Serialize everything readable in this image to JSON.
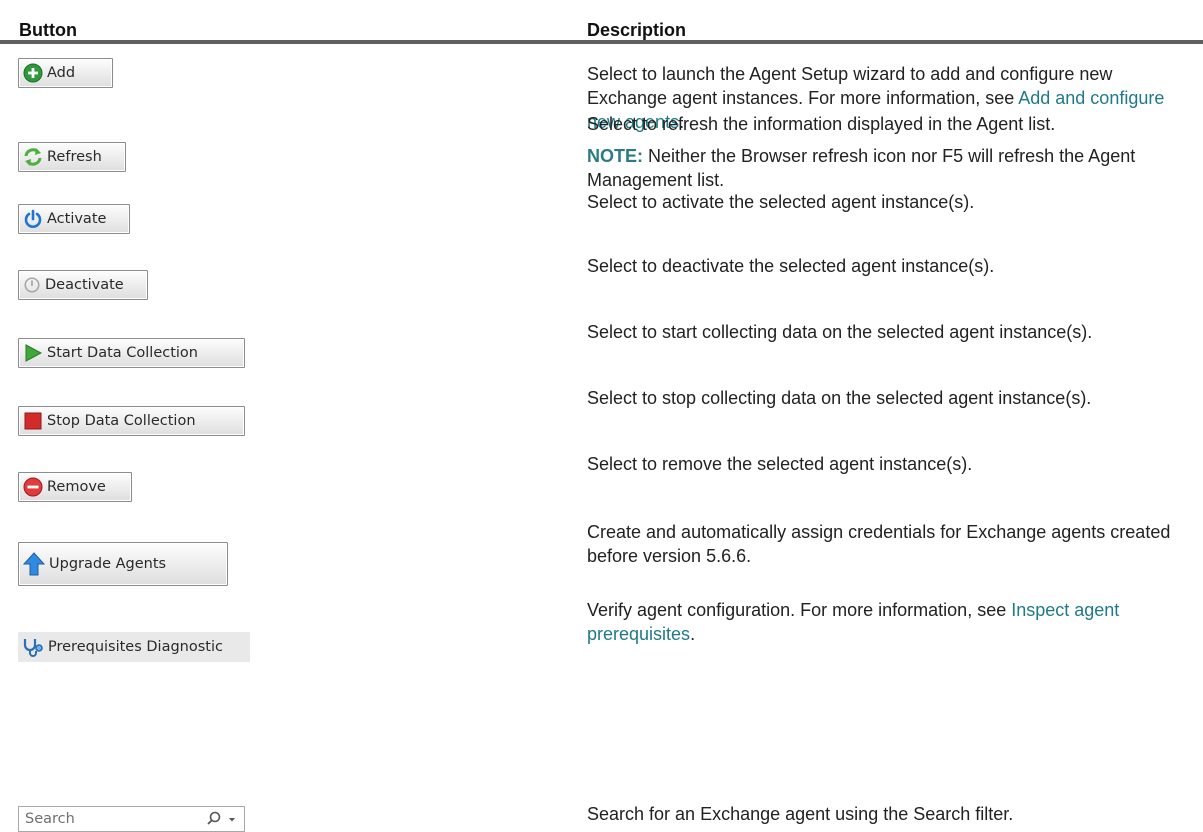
{
  "table": {
    "header": {
      "button": "Button",
      "description": "Description"
    },
    "rows": [
      {
        "button_label": "Add",
        "description": "Select to launch the Agent Setup wizard to add and configure new Exchange agent instances. For more information, see ",
        "link": "Add and configure new agents",
        "after_link": "."
      },
      {
        "button_label": "Refresh",
        "description": "Select to refresh the information displayed in the Agent list.",
        "note_label": "NOTE:",
        "note_text": " Neither the Browser refresh icon nor F5 will refresh the Agent Management list."
      },
      {
        "button_label": "Activate",
        "description": "Select to activate the selected agent instance(s)."
      },
      {
        "button_label": "Deactivate",
        "description": "Select to deactivate the selected agent instance(s)."
      },
      {
        "button_label": "Start Data Collection",
        "description": "Select to start collecting data on the selected agent instance(s)."
      },
      {
        "button_label": "Stop Data Collection",
        "description": "Select to stop collecting data on the selected agent instance(s)."
      },
      {
        "button_label": "Remove",
        "description": "Select to remove the selected agent instance(s)."
      },
      {
        "button_label": "Upgrade Agents",
        "description": "Create and automatically assign credentials for Exchange agents created before version 5.6.6."
      },
      {
        "button_label": "Prerequisites Diagnostic",
        "description": "Verify agent configuration. For more information, see ",
        "link": "Inspect agent prerequisites",
        "after_link": "."
      },
      {
        "search_placeholder": "Search",
        "description": "Search for an Exchange agent using the Search filter."
      }
    ]
  },
  "colors": {
    "link": "#1f7a87",
    "note": "#2b7a86",
    "header_rule": "#606060"
  },
  "icons": {
    "add": "plus-circle-icon",
    "refresh": "refresh-arrows-icon",
    "activate": "power-icon",
    "deactivate": "power-disabled-icon",
    "start": "play-icon",
    "stop": "stop-square-icon",
    "remove": "minus-circle-icon",
    "upgrade": "arrow-up-icon",
    "prerequisites": "stethoscope-icon",
    "search": "search-icon",
    "dropdown": "chevron-down-icon"
  }
}
